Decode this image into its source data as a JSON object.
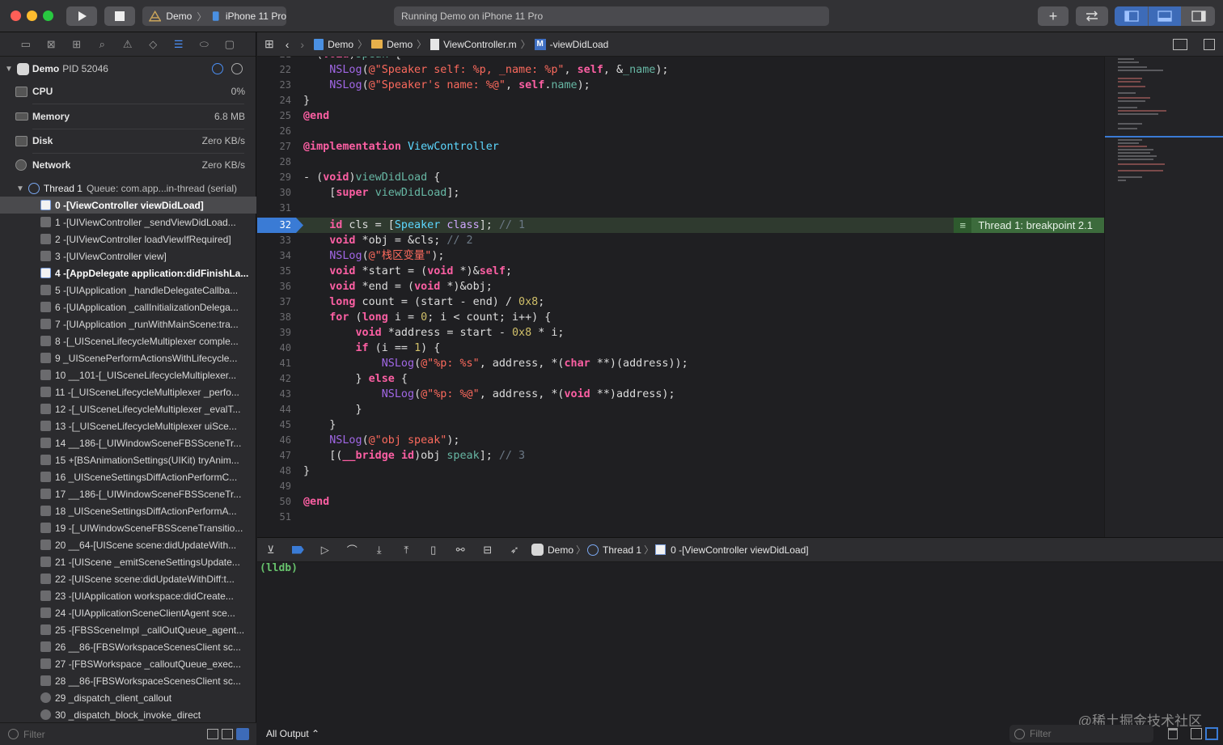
{
  "toolbar": {
    "scheme_target": "Demo",
    "scheme_device": "iPhone 11 Pro",
    "activity_status": "Running Demo on iPhone 11 Pro"
  },
  "navigator": {
    "process": {
      "name": "Demo",
      "pid": "PID 52046"
    },
    "gauges": [
      {
        "label": "CPU",
        "value": "0%"
      },
      {
        "label": "Memory",
        "value": "6.8 MB"
      },
      {
        "label": "Disk",
        "value": "Zero KB/s"
      },
      {
        "label": "Network",
        "value": "Zero KB/s"
      }
    ],
    "thread": {
      "name": "Thread 1",
      "queue": "Queue: com.app...in-thread (serial)"
    },
    "frames": [
      "0 -[ViewController viewDidLoad]",
      "1 -[UIViewController _sendViewDidLoad...",
      "2 -[UIViewController loadViewIfRequired]",
      "3 -[UIViewController view]",
      "4 -[AppDelegate application:didFinishLa...",
      "5 -[UIApplication _handleDelegateCallba...",
      "6 -[UIApplication _callInitializationDelega...",
      "7 -[UIApplication _runWithMainScene:tra...",
      "8 -[_UISceneLifecycleMultiplexer comple...",
      "9 _UIScenePerformActionsWithLifecycle...",
      "10 __101-[_UISceneLifecycleMultiplexer...",
      "11 -[_UISceneLifecycleMultiplexer _perfo...",
      "12 -[_UISceneLifecycleMultiplexer _evalT...",
      "13 -[_UISceneLifecycleMultiplexer uiSce...",
      "14 __186-[_UIWindowSceneFBSSceneTr...",
      "15 +[BSAnimationSettings(UIKit) tryAnim...",
      "16 _UISceneSettingsDiffActionPerformC...",
      "17 __186-[_UIWindowSceneFBSSceneTr...",
      "18 _UISceneSettingsDiffActionPerformA...",
      "19 -[_UIWindowSceneFBSSceneTransitio...",
      "20 __64-[UIScene scene:didUpdateWith...",
      "21 -[UIScene _emitSceneSettingsUpdate...",
      "22 -[UIScene scene:didUpdateWithDiff:t...",
      "23 -[UIApplication workspace:didCreate...",
      "24 -[UIApplicationSceneClientAgent sce...",
      "25 -[FBSSceneImpl _callOutQueue_agent...",
      "26 __86-[FBSWorkspaceScenesClient sc...",
      "27 -[FBSWorkspace _calloutQueue_exec...",
      "28 __86-[FBSWorkspaceScenesClient sc...",
      "29 _dispatch_client_callout",
      "30 _dispatch_block_invoke_direct"
    ],
    "filter_placeholder": "Filter"
  },
  "jumpbar": {
    "crumbs": [
      "Demo",
      "Demo",
      "ViewController.m",
      "-viewDidLoad"
    ]
  },
  "editor": {
    "line_numbers": [
      "21",
      "22",
      "23",
      "24",
      "25",
      "26",
      "27",
      "28",
      "29",
      "30",
      "31",
      "32",
      "33",
      "34",
      "35",
      "36",
      "37",
      "38",
      "39",
      "40",
      "41",
      "42",
      "43",
      "44",
      "45",
      "46",
      "47",
      "48",
      "49",
      "50",
      "51"
    ],
    "current_line": "32",
    "thread_badge": "Thread 1: breakpoint 2.1"
  },
  "debugbar": {
    "crumbs": [
      "Demo",
      "Thread 1",
      "0 -[ViewController viewDidLoad]"
    ]
  },
  "console": {
    "prompt": "(lldb)",
    "output_selector": "All Output ⌃",
    "filter_placeholder": "Filter",
    "watermark": "@稀土掘金技术社区"
  }
}
